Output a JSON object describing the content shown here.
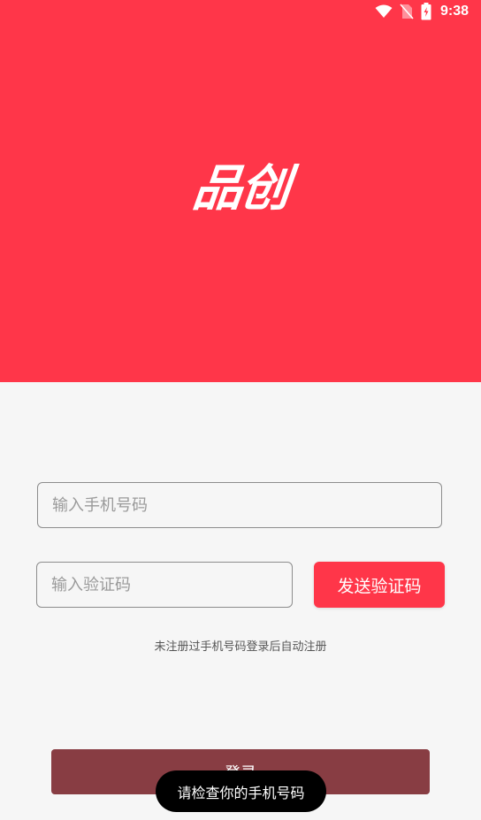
{
  "status_bar": {
    "time": "9:38",
    "icons": [
      "wifi-icon",
      "no-sim-icon",
      "battery-charging-icon"
    ]
  },
  "header": {
    "logo_text": "品创"
  },
  "form": {
    "phone_placeholder": "输入手机号码",
    "phone_value": "",
    "code_placeholder": "输入验证码",
    "code_value": "",
    "send_code_label": "发送验证码",
    "hint": "未注册过手机号码登录后自动注册",
    "login_label": "登录"
  },
  "toast": {
    "message": "请检查你的手机号码"
  },
  "colors": {
    "accent": "#ff3649",
    "login_button_dimmed": "#883d43",
    "background": "#f6f6f6",
    "toast_background": "#000000"
  }
}
